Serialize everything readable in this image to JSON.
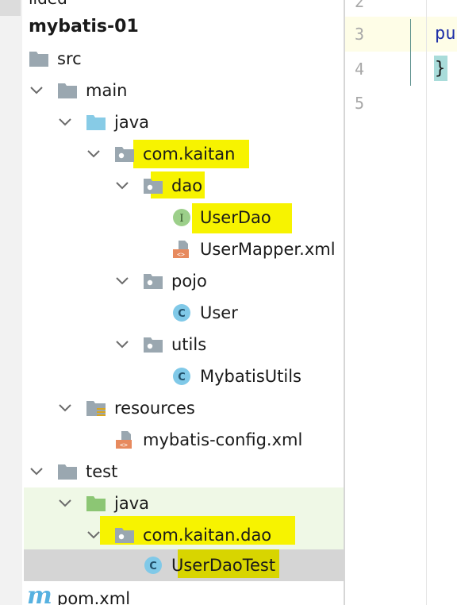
{
  "project_tree": {
    "top_cut_label": "ilded",
    "project_name": "mybatis-01",
    "nodes": {
      "src": "src",
      "main": "main",
      "main_java": "java",
      "main_pkg": "com.kaitan",
      "dao": "dao",
      "user_dao": "UserDao",
      "user_mapper": "UserMapper.xml",
      "pojo": "pojo",
      "user": "User",
      "utils": "utils",
      "mybatis_utils": "MybatisUtils",
      "resources": "resources",
      "mybatis_config": "mybatis-config.xml",
      "test": "test",
      "test_java": "java",
      "test_pkg": "com.kaitan.dao",
      "user_dao_test": "UserDaoTest",
      "pom": "pom.xml"
    },
    "selected_node": "UserDaoTest",
    "highlight_color": "#f7f300"
  },
  "editor": {
    "lines": [
      {
        "number": "2",
        "code": ""
      },
      {
        "number": "3",
        "code": "pu"
      },
      {
        "number": "4",
        "code": "}"
      },
      {
        "number": "5",
        "code": ""
      }
    ],
    "current_line": "3"
  },
  "icons": {
    "folder": "folder-icon",
    "source_folder": "source-folder-icon",
    "test_folder": "test-source-folder-icon",
    "package": "package-icon",
    "resources_folder": "resources-folder-icon",
    "interface": "interface-icon",
    "class": "class-icon",
    "xml_file": "xml-file-icon",
    "maven": "maven-icon",
    "chevron": "chevron-down-icon"
  }
}
